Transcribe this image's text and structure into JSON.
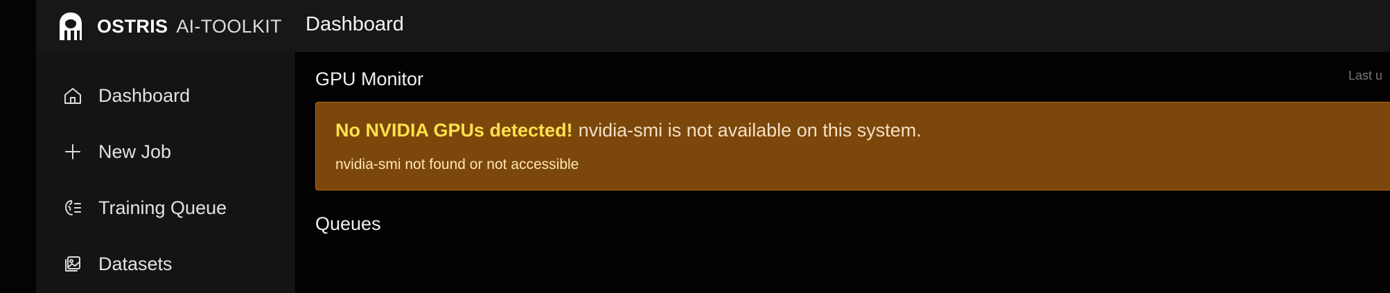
{
  "brand": {
    "strong": "OSTRIS",
    "light": "AI-TOOLKIT"
  },
  "header": {
    "title": "Dashboard"
  },
  "sidebar": {
    "items": [
      {
        "label": "Dashboard",
        "icon": "home-icon"
      },
      {
        "label": "New Job",
        "icon": "plus-icon"
      },
      {
        "label": "Training Queue",
        "icon": "training-queue-icon"
      },
      {
        "label": "Datasets",
        "icon": "image-icon"
      }
    ]
  },
  "gpu_monitor": {
    "title": "GPU Monitor",
    "last_updated": "Last u",
    "alert": {
      "heading": "No NVIDIA GPUs detected!",
      "message": "nvidia-smi is not available on this system.",
      "detail": "nvidia-smi not found or not accessible"
    }
  },
  "queues": {
    "title": "Queues"
  },
  "colors": {
    "background": "#020202",
    "sidebar": "#141414",
    "alert_background": "#7b470b",
    "alert_heading": "#ffe14b"
  }
}
